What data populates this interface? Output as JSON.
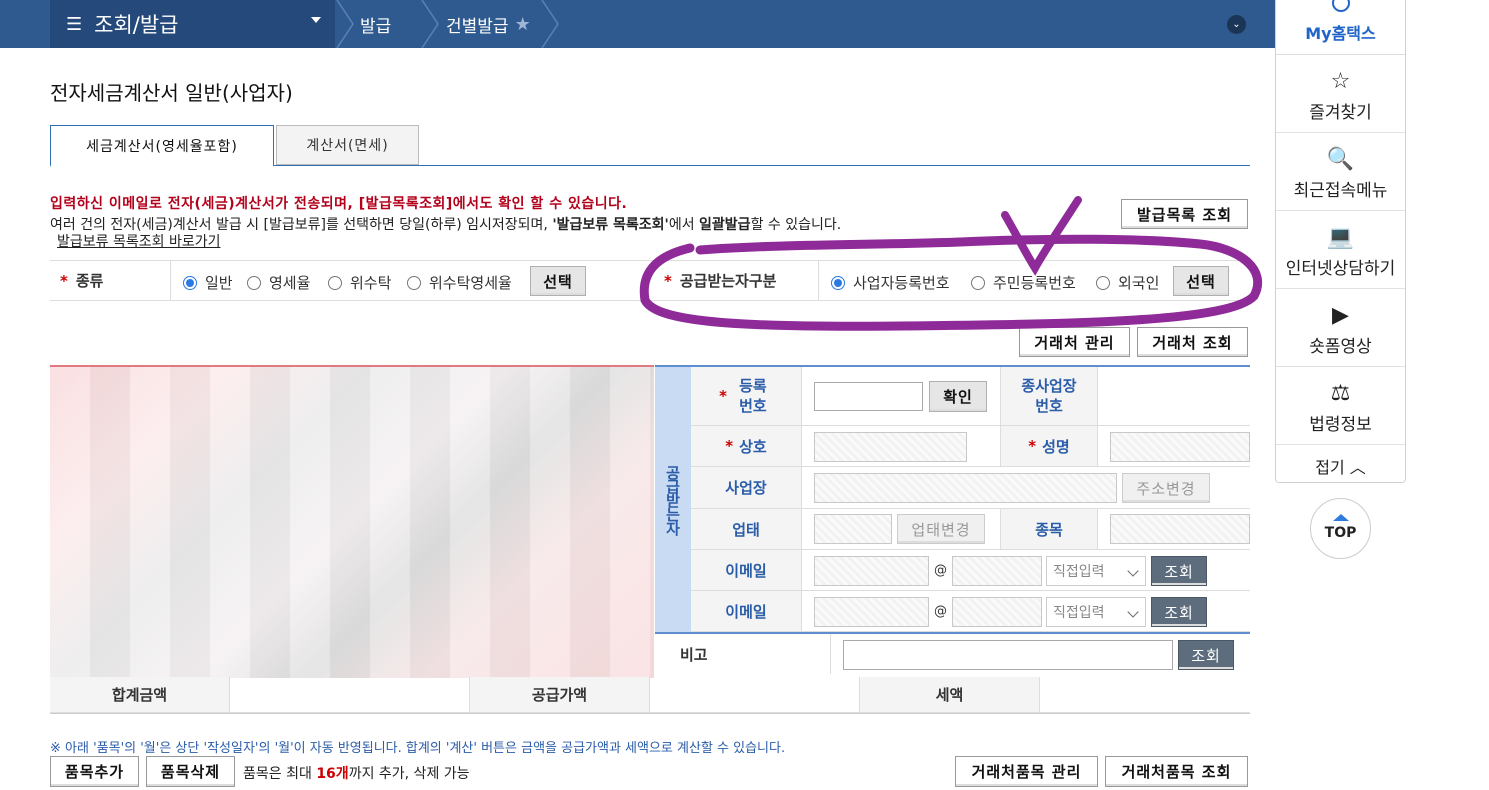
{
  "nav": {
    "menu_label": "조회/발급",
    "crumb1": "발급",
    "crumb2": "건별발급"
  },
  "sidebar": {
    "my": "My홈택스",
    "items": [
      {
        "label": "즐겨찾기",
        "icon": "star-icon"
      },
      {
        "label": "최근접속메뉴",
        "icon": "recent-menu-icon"
      },
      {
        "label": "인터넷상담하기",
        "icon": "consult-icon"
      },
      {
        "label": "숏폼영상",
        "icon": "video-icon"
      },
      {
        "label": "법령정보",
        "icon": "gavel-icon"
      }
    ],
    "fold": "접기",
    "top": "TOP"
  },
  "page": {
    "title": "전자세금계산서 일반(사업자)",
    "tabs": [
      "세금계산서(영세율포함)",
      "계산서(면세)"
    ],
    "notice_red": "입력하신 이메일로 전자(세금)계산서가 전송되며, [발급목록조회]에서도 확인 할 수 있습니다.",
    "notice2_a": "여러 건의 전자(세금)계산서 발급 시 [발급보류]를 선택하면 당일(하루) 임시저장되며, ",
    "notice2_b": "'발급보류 목록조회'",
    "notice2_c": "에서 ",
    "notice2_d": "일괄발급",
    "notice2_e": "할 수 있습니다.",
    "notice_link": "발급보류 목록조회 바로가기",
    "issue_list_btn": "발급목록 조회"
  },
  "kind": {
    "label": "종류",
    "options": [
      "일반",
      "영세율",
      "위수탁",
      "위수탁영세율"
    ],
    "selected": "일반",
    "select_btn": "선택"
  },
  "recv_type": {
    "label": "공급받는자구분",
    "options": [
      "사업자등록번호",
      "주민등록번호",
      "외국인"
    ],
    "selected": "사업자등록번호",
    "select_btn": "선택"
  },
  "partner": {
    "manage_btn": "거래처 관리",
    "search_btn": "거래처 조회"
  },
  "receiver": {
    "side_label": "공급받는자",
    "reg_label": "등록번호",
    "confirm_btn": "확인",
    "sub_label": "종사업장번호",
    "company_label": "상호",
    "name_label": "성명",
    "addr_label": "사업장",
    "addr_btn": "주소변경",
    "biz_label": "업태",
    "biz_btn": "업태변경",
    "item_label": "종목",
    "email_label": "이메일",
    "email_at": "@",
    "email_select": "직접입력",
    "email_btn": "조회",
    "remark_label": "비고",
    "remark_btn": "조회"
  },
  "totals": {
    "sum_label": "합계금액",
    "supply_label": "공급가액",
    "tax_label": "세액"
  },
  "items": {
    "note": "※ 아래 '품목'의 '월'은 상단 '작성일자'의 '월'이 자동 반영됩니다. 합계의 '계산' 버튼은 금액을 공급가액과 세액으로 계산할 수 있습니다.",
    "add_btn": "품목추가",
    "del_btn": "품목삭제",
    "limit_a": "품목은 최대 ",
    "limit_b": "16개",
    "limit_c": "까지 추가, 삭제 가능",
    "manage_btn": "거래처품목 관리",
    "search_btn": "거래처품목 조회"
  }
}
